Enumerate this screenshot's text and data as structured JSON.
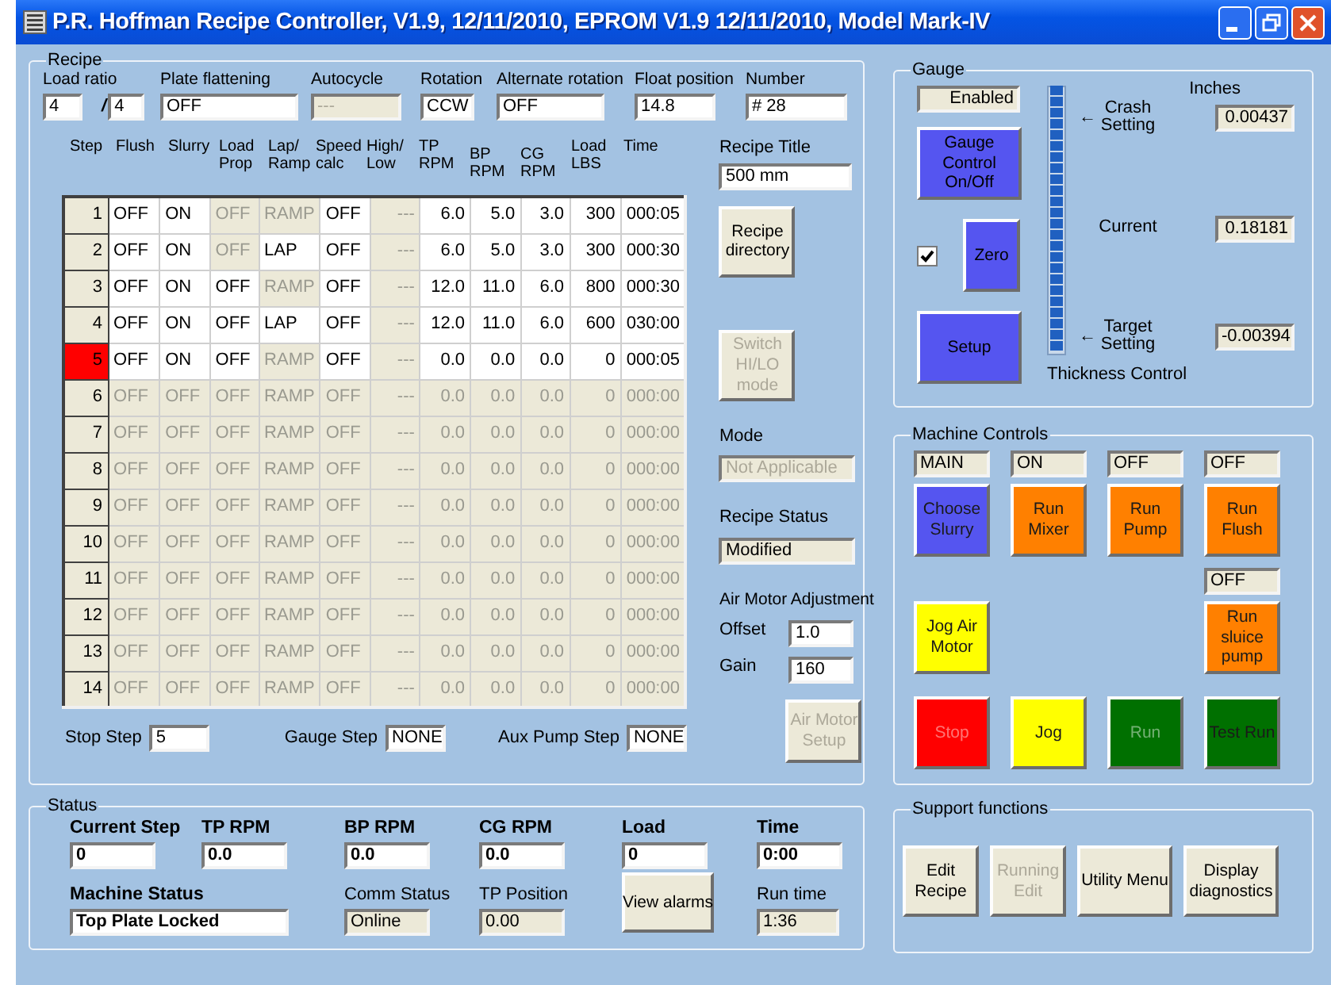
{
  "window": {
    "title": "P.R. Hoffman Recipe Controller, V1.9, 12/11/2010, EPROM V1.9 12/11/2010, Model Mark-IV"
  },
  "recipe": {
    "title": "Recipe",
    "load_ratio": {
      "label": "Load ratio",
      "value": "4",
      "separator": "/",
      "value2": "4"
    },
    "fields": [
      {
        "label": "Plate flattening",
        "value": "OFF",
        "disabled": false
      },
      {
        "label": "Autocycle",
        "value": "---",
        "disabled": true
      },
      {
        "label": "Rotation",
        "value": "CCW",
        "disabled": false
      },
      {
        "label": "Alternate rotation",
        "value": "OFF",
        "disabled": false
      },
      {
        "label": "Float position",
        "value": "14.8",
        "disabled": false
      },
      {
        "label": "Number",
        "value": "# 28",
        "disabled": false
      }
    ],
    "table": {
      "step_header": "Step",
      "columns": [
        "Flush",
        "Slurry",
        "Load Prop",
        "Lap/ Ramp",
        "Speed calc",
        "High/ Low",
        "TP RPM",
        "BP RPM",
        "CG RPM",
        "Load LBS",
        "Time"
      ],
      "rows": [
        {
          "step": "1",
          "selected": false,
          "cells": [
            {
              "text": "OFF",
              "enabled": true
            },
            {
              "text": "ON",
              "enabled": true
            },
            {
              "text": "OFF",
              "enabled": false
            },
            {
              "text": "RAMP",
              "enabled": false
            },
            {
              "text": "OFF",
              "enabled": true
            },
            {
              "text": "---",
              "enabled": false
            },
            {
              "text": "6.0",
              "enabled": true
            },
            {
              "text": "5.0",
              "enabled": true
            },
            {
              "text": "3.0",
              "enabled": true
            },
            {
              "text": "300",
              "enabled": true
            },
            {
              "text": "000:05",
              "enabled": true
            }
          ]
        },
        {
          "step": "2",
          "selected": false,
          "cells": [
            {
              "text": "OFF",
              "enabled": true
            },
            {
              "text": "ON",
              "enabled": true
            },
            {
              "text": "OFF",
              "enabled": false
            },
            {
              "text": "LAP",
              "enabled": true
            },
            {
              "text": "OFF",
              "enabled": true
            },
            {
              "text": "---",
              "enabled": false
            },
            {
              "text": "6.0",
              "enabled": true
            },
            {
              "text": "5.0",
              "enabled": true
            },
            {
              "text": "3.0",
              "enabled": true
            },
            {
              "text": "300",
              "enabled": true
            },
            {
              "text": "000:30",
              "enabled": true
            }
          ]
        },
        {
          "step": "3",
          "selected": false,
          "cells": [
            {
              "text": "OFF",
              "enabled": true
            },
            {
              "text": "ON",
              "enabled": true
            },
            {
              "text": "OFF",
              "enabled": true
            },
            {
              "text": "RAMP",
              "enabled": false
            },
            {
              "text": "OFF",
              "enabled": true
            },
            {
              "text": "---",
              "enabled": false
            },
            {
              "text": "12.0",
              "enabled": true
            },
            {
              "text": "11.0",
              "enabled": true
            },
            {
              "text": "6.0",
              "enabled": true
            },
            {
              "text": "800",
              "enabled": true
            },
            {
              "text": "000:30",
              "enabled": true
            }
          ]
        },
        {
          "step": "4",
          "selected": false,
          "cells": [
            {
              "text": "OFF",
              "enabled": true
            },
            {
              "text": "ON",
              "enabled": true
            },
            {
              "text": "OFF",
              "enabled": true
            },
            {
              "text": "LAP",
              "enabled": true
            },
            {
              "text": "OFF",
              "enabled": true
            },
            {
              "text": "---",
              "enabled": false
            },
            {
              "text": "12.0",
              "enabled": true
            },
            {
              "text": "11.0",
              "enabled": true
            },
            {
              "text": "6.0",
              "enabled": true
            },
            {
              "text": "600",
              "enabled": true
            },
            {
              "text": "030:00",
              "enabled": true
            }
          ]
        },
        {
          "step": "5",
          "selected": true,
          "cells": [
            {
              "text": "OFF",
              "enabled": true
            },
            {
              "text": "ON",
              "enabled": true
            },
            {
              "text": "OFF",
              "enabled": true
            },
            {
              "text": "RAMP",
              "enabled": false
            },
            {
              "text": "OFF",
              "enabled": true
            },
            {
              "text": "---",
              "enabled": false
            },
            {
              "text": "0.0",
              "enabled": true
            },
            {
              "text": "0.0",
              "enabled": true
            },
            {
              "text": "0.0",
              "enabled": true
            },
            {
              "text": "0",
              "enabled": true
            },
            {
              "text": "000:05",
              "enabled": true
            }
          ]
        },
        {
          "step": "6",
          "selected": false,
          "cells": [
            {
              "text": "OFF",
              "enabled": false
            },
            {
              "text": "OFF",
              "enabled": false
            },
            {
              "text": "OFF",
              "enabled": false
            },
            {
              "text": "RAMP",
              "enabled": false
            },
            {
              "text": "OFF",
              "enabled": false
            },
            {
              "text": "---",
              "enabled": false
            },
            {
              "text": "0.0",
              "enabled": false
            },
            {
              "text": "0.0",
              "enabled": false
            },
            {
              "text": "0.0",
              "enabled": false
            },
            {
              "text": "0",
              "enabled": false
            },
            {
              "text": "000:00",
              "enabled": false
            }
          ]
        },
        {
          "step": "7",
          "selected": false,
          "cells": [
            {
              "text": "OFF",
              "enabled": false
            },
            {
              "text": "OFF",
              "enabled": false
            },
            {
              "text": "OFF",
              "enabled": false
            },
            {
              "text": "RAMP",
              "enabled": false
            },
            {
              "text": "OFF",
              "enabled": false
            },
            {
              "text": "---",
              "enabled": false
            },
            {
              "text": "0.0",
              "enabled": false
            },
            {
              "text": "0.0",
              "enabled": false
            },
            {
              "text": "0.0",
              "enabled": false
            },
            {
              "text": "0",
              "enabled": false
            },
            {
              "text": "000:00",
              "enabled": false
            }
          ]
        },
        {
          "step": "8",
          "selected": false,
          "cells": [
            {
              "text": "OFF",
              "enabled": false
            },
            {
              "text": "OFF",
              "enabled": false
            },
            {
              "text": "OFF",
              "enabled": false
            },
            {
              "text": "RAMP",
              "enabled": false
            },
            {
              "text": "OFF",
              "enabled": false
            },
            {
              "text": "---",
              "enabled": false
            },
            {
              "text": "0.0",
              "enabled": false
            },
            {
              "text": "0.0",
              "enabled": false
            },
            {
              "text": "0.0",
              "enabled": false
            },
            {
              "text": "0",
              "enabled": false
            },
            {
              "text": "000:00",
              "enabled": false
            }
          ]
        },
        {
          "step": "9",
          "selected": false,
          "cells": [
            {
              "text": "OFF",
              "enabled": false
            },
            {
              "text": "OFF",
              "enabled": false
            },
            {
              "text": "OFF",
              "enabled": false
            },
            {
              "text": "RAMP",
              "enabled": false
            },
            {
              "text": "OFF",
              "enabled": false
            },
            {
              "text": "---",
              "enabled": false
            },
            {
              "text": "0.0",
              "enabled": false
            },
            {
              "text": "0.0",
              "enabled": false
            },
            {
              "text": "0.0",
              "enabled": false
            },
            {
              "text": "0",
              "enabled": false
            },
            {
              "text": "000:00",
              "enabled": false
            }
          ]
        },
        {
          "step": "10",
          "selected": false,
          "cells": [
            {
              "text": "OFF",
              "enabled": false
            },
            {
              "text": "OFF",
              "enabled": false
            },
            {
              "text": "OFF",
              "enabled": false
            },
            {
              "text": "RAMP",
              "enabled": false
            },
            {
              "text": "OFF",
              "enabled": false
            },
            {
              "text": "---",
              "enabled": false
            },
            {
              "text": "0.0",
              "enabled": false
            },
            {
              "text": "0.0",
              "enabled": false
            },
            {
              "text": "0.0",
              "enabled": false
            },
            {
              "text": "0",
              "enabled": false
            },
            {
              "text": "000:00",
              "enabled": false
            }
          ]
        },
        {
          "step": "11",
          "selected": false,
          "cells": [
            {
              "text": "OFF",
              "enabled": false
            },
            {
              "text": "OFF",
              "enabled": false
            },
            {
              "text": "OFF",
              "enabled": false
            },
            {
              "text": "RAMP",
              "enabled": false
            },
            {
              "text": "OFF",
              "enabled": false
            },
            {
              "text": "---",
              "enabled": false
            },
            {
              "text": "0.0",
              "enabled": false
            },
            {
              "text": "0.0",
              "enabled": false
            },
            {
              "text": "0.0",
              "enabled": false
            },
            {
              "text": "0",
              "enabled": false
            },
            {
              "text": "000:00",
              "enabled": false
            }
          ]
        },
        {
          "step": "12",
          "selected": false,
          "cells": [
            {
              "text": "OFF",
              "enabled": false
            },
            {
              "text": "OFF",
              "enabled": false
            },
            {
              "text": "OFF",
              "enabled": false
            },
            {
              "text": "RAMP",
              "enabled": false
            },
            {
              "text": "OFF",
              "enabled": false
            },
            {
              "text": "---",
              "enabled": false
            },
            {
              "text": "0.0",
              "enabled": false
            },
            {
              "text": "0.0",
              "enabled": false
            },
            {
              "text": "0.0",
              "enabled": false
            },
            {
              "text": "0",
              "enabled": false
            },
            {
              "text": "000:00",
              "enabled": false
            }
          ]
        },
        {
          "step": "13",
          "selected": false,
          "cells": [
            {
              "text": "OFF",
              "enabled": false
            },
            {
              "text": "OFF",
              "enabled": false
            },
            {
              "text": "OFF",
              "enabled": false
            },
            {
              "text": "RAMP",
              "enabled": false
            },
            {
              "text": "OFF",
              "enabled": false
            },
            {
              "text": "---",
              "enabled": false
            },
            {
              "text": "0.0",
              "enabled": false
            },
            {
              "text": "0.0",
              "enabled": false
            },
            {
              "text": "0.0",
              "enabled": false
            },
            {
              "text": "0",
              "enabled": false
            },
            {
              "text": "000:00",
              "enabled": false
            }
          ]
        },
        {
          "step": "14",
          "selected": false,
          "cells": [
            {
              "text": "OFF",
              "enabled": false
            },
            {
              "text": "OFF",
              "enabled": false
            },
            {
              "text": "OFF",
              "enabled": false
            },
            {
              "text": "RAMP",
              "enabled": false
            },
            {
              "text": "OFF",
              "enabled": false
            },
            {
              "text": "---",
              "enabled": false
            },
            {
              "text": "0.0",
              "enabled": false
            },
            {
              "text": "0.0",
              "enabled": false
            },
            {
              "text": "0.0",
              "enabled": false
            },
            {
              "text": "0",
              "enabled": false
            },
            {
              "text": "000:00",
              "enabled": false
            }
          ]
        }
      ]
    },
    "side": [
      {
        "kind": "entry",
        "label": "Recipe Title",
        "value": "500 mm",
        "disabled": false
      },
      {
        "kind": "button",
        "label": "Recipe directory",
        "disabled": false
      },
      {
        "kind": "button",
        "label": "Switch HI/LO mode",
        "disabled": true
      },
      {
        "kind": "readout",
        "label": "Mode",
        "value": "Not Applicable",
        "disabled": true
      },
      {
        "kind": "readout",
        "label": "Recipe Status",
        "value": "Modified",
        "disabled": false
      },
      {
        "kind": "heading",
        "label": "Air Motor Adjustment"
      },
      {
        "kind": "inline",
        "label": "Offset",
        "value": "1.0",
        "disabled": false
      },
      {
        "kind": "inline",
        "label": "Gain",
        "value": "160",
        "disabled": false
      },
      {
        "kind": "button",
        "label": "Air Motor Setup",
        "disabled": true
      }
    ],
    "bottom": [
      {
        "label": "Stop Step",
        "value": "5"
      },
      {
        "label": "Gauge Step",
        "value": "NONE"
      },
      {
        "label": "Aux Pump Step",
        "value": "NONE"
      }
    ]
  },
  "status": {
    "title": "Status",
    "readings": [
      {
        "label": "Current Step",
        "value": "0"
      },
      {
        "label": "TP RPM",
        "value": "0.0"
      },
      {
        "label": "BP RPM",
        "value": "0.0"
      },
      {
        "label": "CG RPM",
        "value": "0.0"
      },
      {
        "label": "Load",
        "value": "0"
      },
      {
        "label": "Time",
        "value": "0:00"
      }
    ],
    "machine_status": {
      "label": "Machine Status",
      "value": "Top Plate Locked"
    },
    "info": [
      {
        "label": "Comm Status",
        "value": "Online"
      },
      {
        "label": "TP Position",
        "value": "0.00"
      }
    ],
    "alarms_button": "View alarms",
    "run_time": {
      "label": "Run time",
      "value": "1:36"
    }
  },
  "gauge": {
    "title": "Gauge",
    "state": "Enabled",
    "control_button": "Gauge Control On/Off",
    "zero_checked": true,
    "zero_button": "Zero",
    "setup_button": "Setup",
    "meter": {
      "label": "Thickness Control",
      "level": 1
    },
    "units": "Inches",
    "readouts": [
      {
        "arrow": "←",
        "label": "Crash Setting",
        "value": "0.00437"
      },
      {
        "label": "Current",
        "value": "0.18181"
      },
      {
        "arrow": "←",
        "label": "Target Setting",
        "value": "-0.00394"
      }
    ]
  },
  "machine_controls": {
    "title": "Machine Controls",
    "rows": [
      [
        {
          "kind": "button",
          "readout": "MAIN",
          "label": "Choose Slurry",
          "color": "#5555f0",
          "disabled": false
        },
        {
          "kind": "button",
          "readout": "ON",
          "label": "Run Mixer",
          "color": "#ff8000",
          "disabled": false
        },
        {
          "kind": "button",
          "readout": "OFF",
          "label": "Run Pump",
          "color": "#ff8000",
          "disabled": false
        },
        {
          "kind": "button",
          "readout": "OFF",
          "label": "Run Flush",
          "color": "#ff8000",
          "disabled": false
        }
      ],
      [
        {
          "kind": "button",
          "label": "Jog Air Motor",
          "color": "#ffff00",
          "disabled": false
        },
        {
          "kind": "empty"
        },
        {
          "kind": "empty"
        },
        {
          "kind": "button",
          "readout": "OFF",
          "label": "Run sluice pump",
          "color": "#ff8000",
          "disabled": false
        }
      ],
      [
        {
          "kind": "button",
          "label": "Stop",
          "color": "#ff0000",
          "disabled": true
        },
        {
          "kind": "button",
          "label": "Jog",
          "color": "#ffff00",
          "disabled": false
        },
        {
          "kind": "button",
          "label": "Run",
          "color": "#007000",
          "disabled": true
        },
        {
          "kind": "button",
          "label": "Test Run",
          "color": "#007000",
          "disabled": false
        }
      ]
    ]
  },
  "support": {
    "title": "Support functions",
    "buttons": [
      {
        "label": "Edit Recipe",
        "disabled": false
      },
      {
        "label": "Running Edit",
        "disabled": true
      },
      {
        "label": "Utility Menu",
        "disabled": false
      },
      {
        "label": "Display diagnostics",
        "disabled": false
      }
    ]
  }
}
